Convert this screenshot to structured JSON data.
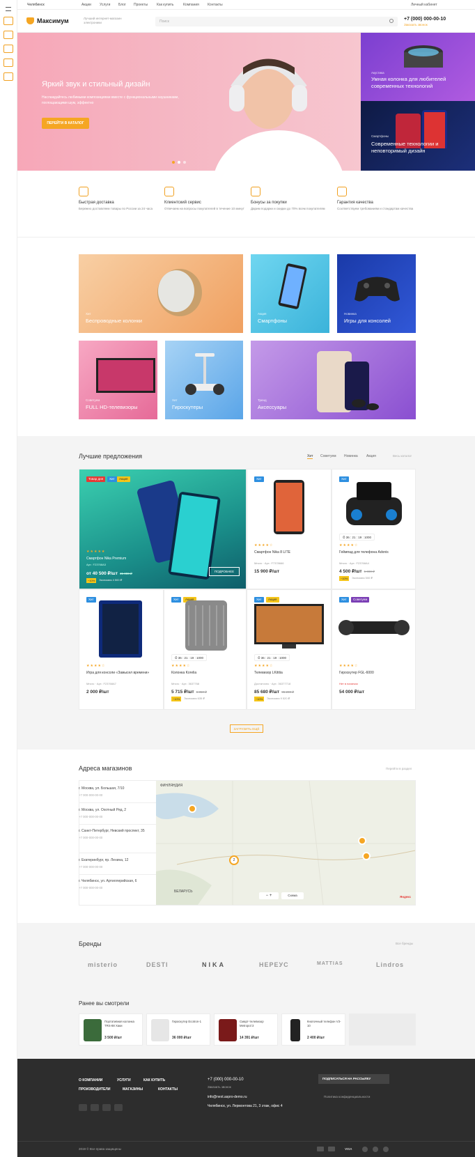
{
  "topbar": {
    "city": "Челябинск",
    "links": [
      "Акции",
      "Услуги",
      "Блог",
      "Проекты",
      "Как купить",
      "Компания",
      "Контакты"
    ],
    "account": "Личный кабинет"
  },
  "header": {
    "logo": "Максимум",
    "tagline": "Лучший интернет-магазин электроники",
    "search_placeholder": "Поиск",
    "phone": "+7 (000) 000-00-10",
    "callback": "Заказать звонок"
  },
  "hero": {
    "title": "Яркий звук и стильный дизайн",
    "subtitle": "Наслаждайтесь любимыми композициями вместе с функциональными наушниками, поглощающими шум, эффектно",
    "button": "ПЕРЕЙТИ В КАТАЛОГ",
    "side1": {
      "tag": "Акустика",
      "title": "Умная колонка для любителей современных технологий"
    },
    "side2": {
      "tag": "Смартфоны",
      "title": "Современные технологии и неповторимый дизайн"
    }
  },
  "features": [
    {
      "title": "Быстрая доставка",
      "desc": "Бережно доставляем товары по России за 24 часа"
    },
    {
      "title": "Клиентский сервис",
      "desc": "Отвечаем на вопросы покупателей в течение 10 минут"
    },
    {
      "title": "Бонусы за покупки",
      "desc": "Дарим подарки и скидки до 70% всем покупателям"
    },
    {
      "title": "Гарантия качества",
      "desc": "Соответствуем требованиям и стандартам качества"
    }
  ],
  "categories": [
    {
      "tag": "Хит",
      "title": "Беспроводные колонки"
    },
    {
      "tag": "Акция",
      "title": "Смартфоны"
    },
    {
      "tag": "Новинка",
      "title": "Игры для консолей"
    },
    {
      "tag": "Советуем",
      "title": "FULL HD-телевизоры"
    },
    {
      "tag": "Хит",
      "title": "Гироскутеры"
    },
    {
      "tag": "Тренд",
      "title": "Аксессуары"
    }
  ],
  "offers": {
    "title": "Лучшие предложения",
    "tabs": [
      "Хит",
      "Советуем",
      "Новинка",
      "Акция"
    ],
    "all_link": "Весь каталог",
    "load_more": "ЗАГРУЗИТЬ ЕЩЁ",
    "big": {
      "badges": [
        "Товар дня",
        "Хит",
        "Акция"
      ],
      "name": "Смартфон Nika Premium",
      "meta": "Арт.: F23768A3",
      "price": "от 40 500 ₽/шт",
      "old": "45 000 ₽",
      "discount": "−10%",
      "economy": "Экономия 4 500 ₽",
      "button": "ПОДРОБНЕЕ"
    },
    "items": [
      {
        "badges": [
          "Хит"
        ],
        "name": "Смартфон Nika 8 LITE",
        "meta": "Много · Арт.: F7378666",
        "price": "15 900 ₽/шт",
        "old": "",
        "discount": "",
        "economy": ""
      },
      {
        "badges": [
          "Хит"
        ],
        "name": "Геймпад для телефона Adonis",
        "meta": "Много · Арт.: F23768A4",
        "price": "4 500 ₽/шт",
        "old": "5 000 ₽",
        "discount": "−10%",
        "economy": "Экономия 500 ₽",
        "timer": [
          "36",
          "21",
          "19",
          "1000"
        ]
      },
      {
        "badges": [
          "Хит"
        ],
        "name": "Игра для консоли «Замысел времени»",
        "meta": "Много · Арт.: F23768A7",
        "price": "2 000 ₽/шт",
        "old": "",
        "discount": "",
        "economy": ""
      },
      {
        "badges": [
          "Хит",
          "Акция"
        ],
        "name": "Колонка Korelia",
        "meta": "Много · Арт.: 3637768",
        "price": "5 715 ₽/шт",
        "old": "6 350 ₽",
        "discount": "−10%",
        "economy": "Экономия 635 ₽",
        "timer": [
          "36",
          "21",
          "19",
          "1000"
        ]
      },
      {
        "badges": [
          "Хит",
          "Акция"
        ],
        "name": "Телевизор LKititia",
        "meta": "Достаточно · Арт.: 36377718",
        "price": "85 680 ₽/шт",
        "old": "95 200 ₽",
        "discount": "−10%",
        "economy": "Экономия 9 520 ₽",
        "timer": [
          "36",
          "21",
          "19",
          "1000"
        ]
      },
      {
        "badges": [
          "Хит",
          "Советуем"
        ],
        "name": "Гироскутер FGL-6000",
        "meta": "Нет в наличии",
        "price": "54 000 ₽/шт",
        "old": "",
        "discount": "",
        "economy": ""
      }
    ]
  },
  "stores": {
    "title": "Адреса магазинов",
    "link": "Перейти в раздел",
    "list": [
      {
        "addr": "г. Москва, ул. Большая, 7/10",
        "phone": "+7 000-000-00-00"
      },
      {
        "addr": "г. Москва, ул. Охотный Ряд, 2",
        "phone": "+7 000-000-00-00"
      },
      {
        "addr": "г. Санкт-Петербург, Невский проспект, 35",
        "phone": "+7 000-000-00-00"
      },
      {
        "addr": "г. Екатеринбург, пр. Ленина, 12",
        "phone": "+7 000-000-00-00"
      },
      {
        "addr": "г. Челябинск, ул. Артиллерийская, 6",
        "phone": "+7 000-000-00-00"
      }
    ],
    "map_labels": [
      "ФИНЛЯНДИЯ",
      "БЕЛАРУСЬ",
      "Схема",
      "Яндекс"
    ],
    "cluster": "2"
  },
  "brands": {
    "title": "Бренды",
    "link": "Все бренды",
    "list": [
      "misterio",
      "DESTI",
      "NIKA",
      "НЕРЕУС",
      "MATTIAS",
      "Lindros"
    ]
  },
  "viewed": {
    "title": "Ранее вы смотрели",
    "items": [
      {
        "name": "Портативная колонка TRS-88 Хаки",
        "price": "3 500 ₽/шт"
      },
      {
        "name": "Гироскутер Ecotron-1",
        "price": "36 000 ₽/шт"
      },
      {
        "name": "Смарт-телевизор Metropol 3",
        "price": "14 391 ₽/шт"
      },
      {
        "name": "Кнопочный телефон V3-10",
        "price": "2 400 ₽/шт"
      }
    ]
  },
  "footer": {
    "nav1": [
      "О КОМПАНИИ",
      "УСЛУГИ",
      "КАК КУПИТЬ"
    ],
    "nav2": [
      "ПРОИЗВОДИТЕЛИ",
      "МАГАЗИНЫ",
      "КОНТАКТЫ"
    ],
    "phone": "+7 (000) 000-00-10",
    "callback": "Заказать звонок",
    "email": "info@next.aspro-demo.ru",
    "address": "Челябинск, ул. Лермонтова 21, 3 этаж, офис 4",
    "subscribe": "ПОДПИСАТЬСЯ НА РАССЫЛКУ",
    "privacy": "Политика конфиденциальности",
    "copyright": "2019 © Все права защищены",
    "payments": [
      "VISA"
    ]
  },
  "colors": {
    "accent": "#f5a623",
    "hit": "#2d8fe0",
    "sale": "#f5c518",
    "daily": "#e53935",
    "recommend": "#7b3fb5",
    "footer": "#2d2d2d"
  }
}
